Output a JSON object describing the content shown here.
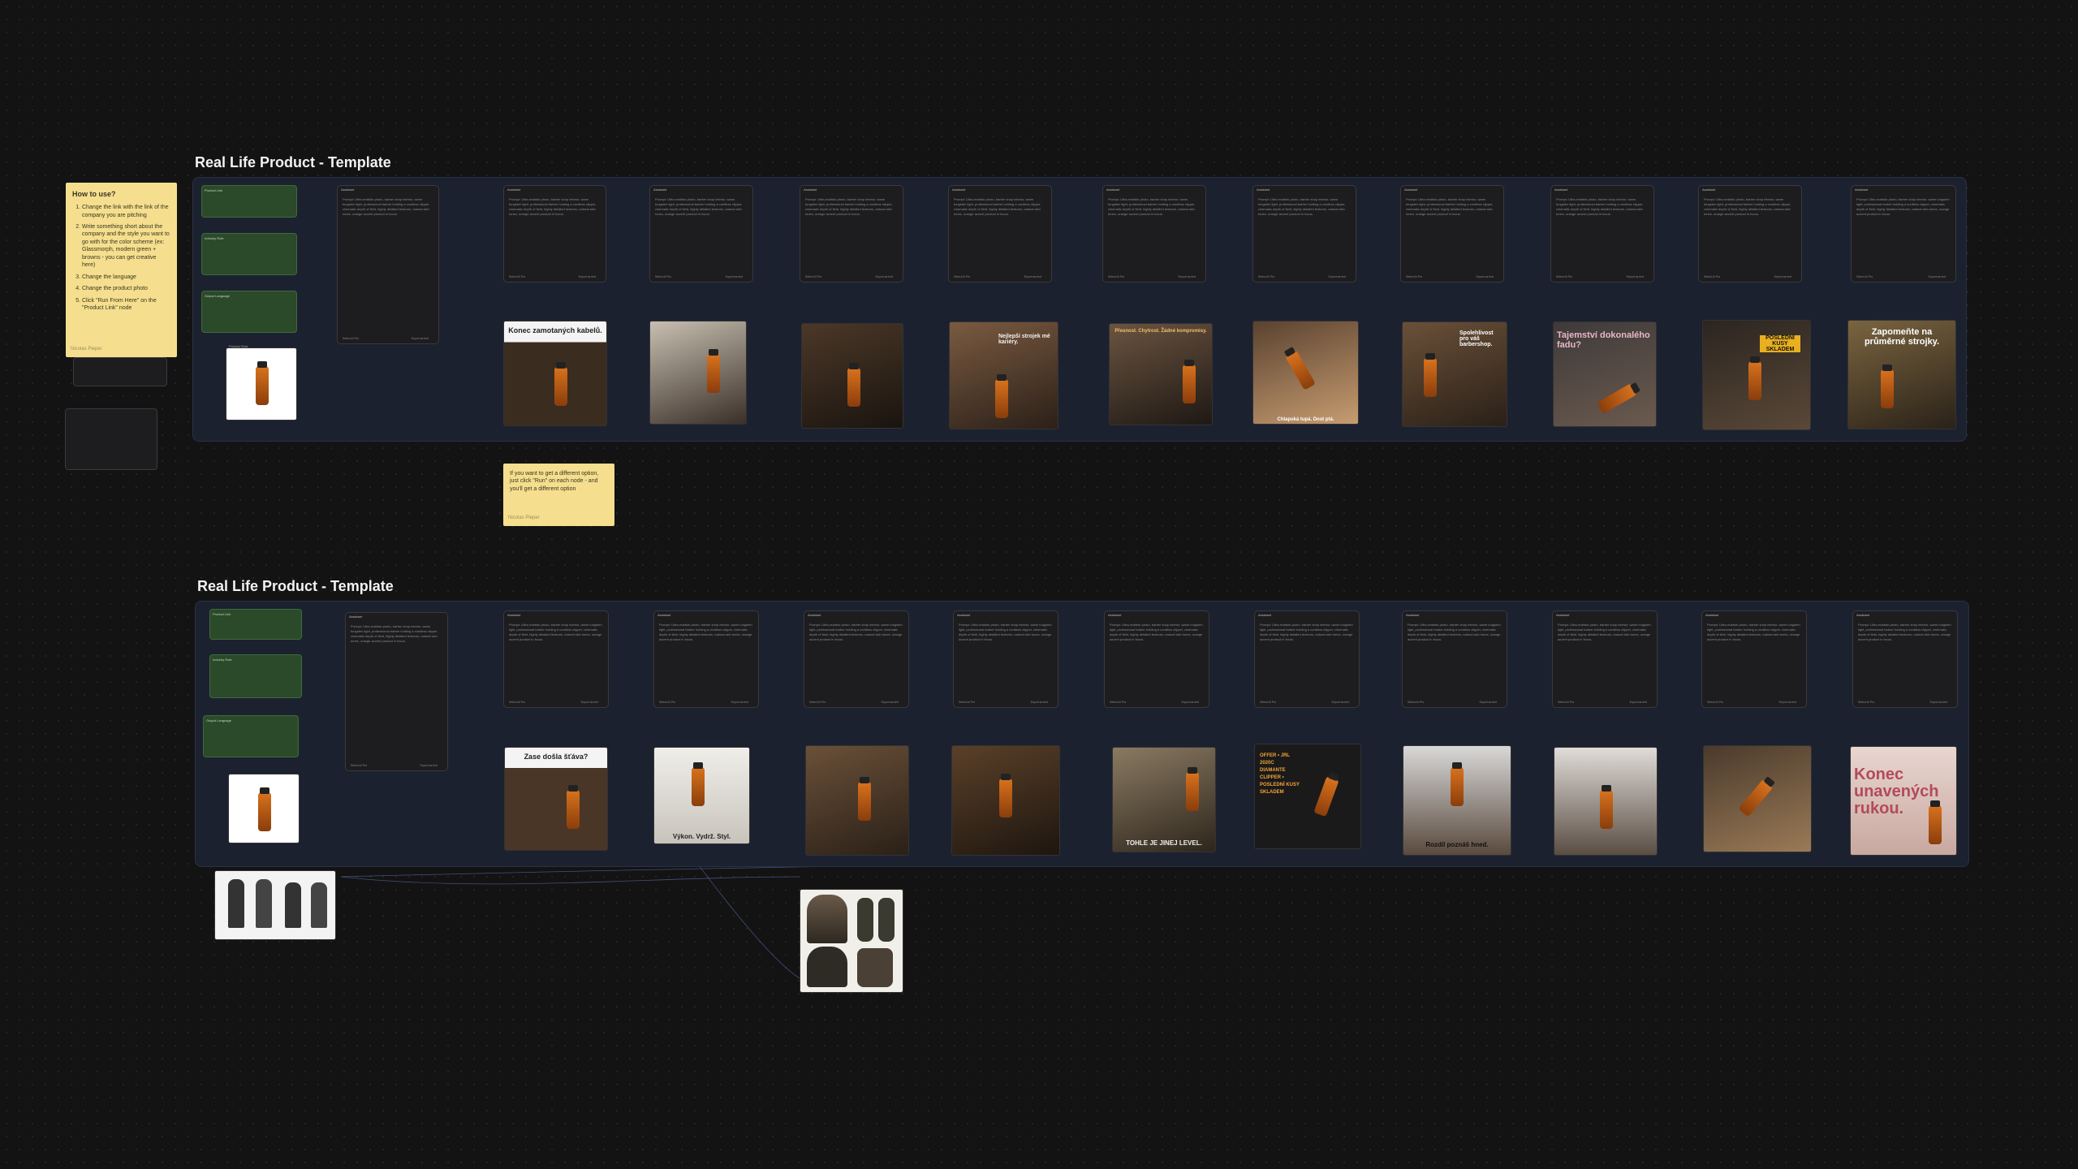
{
  "groups": [
    {
      "title": "Real Life Product - Template"
    },
    {
      "title": "Real Life Product - Template"
    }
  ],
  "how_to": {
    "heading": "How to use?",
    "steps": [
      "Change the link with the link of the company you are pitching",
      "Write something short about the company and the style you want to go with for the color scheme (ex: Glassmorph, modern green + browns - you can get creative here)",
      "Change the language",
      "Change the product photo",
      "Click \"Run From Here\" on the \"Product Link\" node"
    ],
    "author": "Nicolas Pieper"
  },
  "option_note": {
    "text": "If you want to get a different option, just click \"Run\" on each node - and you'll get a different option",
    "author": "Nicolas Pieper"
  },
  "node_labels": {
    "product_link": "Product Link",
    "industry_role": "Industry Role",
    "output_language": "Output Language",
    "product_shot": "Product Shot",
    "assistant": "Assistant",
    "image_gen": "Image Generator",
    "reference": "Reference image",
    "run": "Run all",
    "select": "Select AI Pro",
    "export": "Export as text"
  },
  "text_sample": "Prompt: Ultra-realistic photo, barber shop interior, warm tungsten light, professional barber holding a cordless clipper, cinematic depth of field, highly detailed textures, natural skin tones, orange accent product in focus.",
  "row1_captions": [
    "Konec zamotaných kabelů.",
    "",
    "",
    "Nejlepší strojek mé kariéry.",
    "Přesnost. Chytrost. Žádné kompromisy.",
    "Chlapská tupá. Dost ptá.",
    "Spolehlivost pro váš barbershop.",
    "Tajemství dokonalého fadu?",
    "POSLEDNÍ KUSY SKLADEM",
    "Zapomeňte na průměrné strojky."
  ],
  "row2_captions": [
    "Zase došla šťáva?",
    "Výkon. Vydrž. Styl.",
    "",
    "",
    "TOHLE JE JINEJ LEVEL.",
    "OFFER • JRL 2020C DIAMANTE CLIPPER • POSLEDNÍ KUSY SKLADEM",
    "Rozdíl poznáš hned.",
    "",
    "",
    "Konec unavených rukou."
  ]
}
